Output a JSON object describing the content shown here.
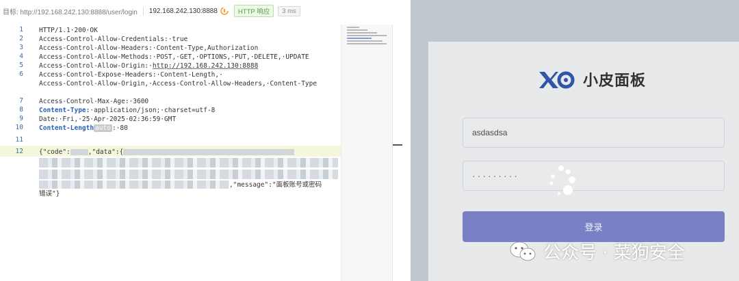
{
  "request_bar": {
    "target_label": "目标: http://192.168.242.130:8888/user/login",
    "host": "192.168.242.130:8888",
    "status_badge": "HTTP 响应",
    "time_badge": "3 ms",
    "copy_icon": "copy-icon"
  },
  "response": {
    "line_numbers": [
      "1",
      "2",
      "3",
      "4",
      "5",
      "6",
      "",
      "7",
      "8",
      "9",
      "10",
      "11",
      "12"
    ],
    "lines": [
      {
        "text": "HTTP/1.1·200·OK"
      },
      {
        "text": "Access-Control-Allow-Credentials:·true"
      },
      {
        "text": "Access-Control-Allow-Headers:·Content-Type,Authorization"
      },
      {
        "text": "Access-Control-Allow-Methods:·POST,·GET,·OPTIONS,·PUT,·DELETE,·UPDATE"
      },
      {
        "key": "Access-Control-Allow-Origin:·",
        "url": "http://192.168.242.130:8888"
      },
      {
        "text": "Access-Control-Expose-Headers:·Content-Length,·"
      },
      {
        "text": "Access-Control-Allow-Origin,·Access-Control-Allow-Headers,·Content-Type"
      },
      {
        "text": "Access-Control-Max-Age:·3600"
      },
      {
        "key": "Content-Type:",
        "text": "·application/json;·charset=utf-8"
      },
      {
        "text": "Date:·Fri,·25·Apr·2025·02:36:59·GMT"
      },
      {
        "key": "Content-Length",
        "badge": "auto",
        "text": ":·80"
      },
      {
        "text": ""
      }
    ],
    "body_start": "{\"code\":",
    "body_data_key": ",\"data\":{",
    "body_message": ",\"message\":\"面板账号或密码",
    "body_end": "错误\"}"
  },
  "login": {
    "app_name": "小皮面板",
    "logo_icon": "xp-logo-icon",
    "username_value": "asdasdsa",
    "password_mask": "·········",
    "login_button": "登录",
    "loading_icon": "spinner-icon"
  },
  "watermark": {
    "text": "公众号 · 菜狗安全",
    "icon": "wechat-icon"
  },
  "colors": {
    "line_number": "#3b6aa3",
    "keyword": "#2a61b8",
    "highlight_line": "#f4f7dc",
    "badge_green": "#52a13b",
    "login_button": "#7a80c6",
    "logo_blue": "#2f55a8"
  }
}
